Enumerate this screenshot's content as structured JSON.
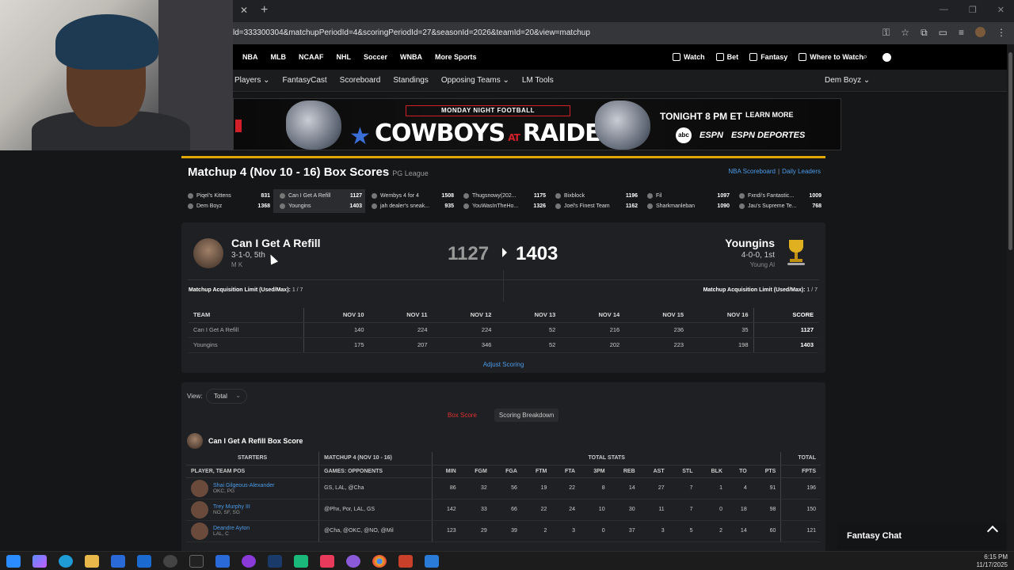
{
  "browser": {
    "url": "ld=333300304&matchupPeriodId=4&scoringPeriodId=27&seasonId=2026&teamId=20&view=matchup"
  },
  "espn_nav": {
    "sports": [
      "NBA",
      "MLB",
      "NCAAF",
      "NHL",
      "Soccer",
      "WNBA",
      "More Sports"
    ],
    "right": [
      "Watch",
      "Bet",
      "Fantasy",
      "Where to Watch"
    ]
  },
  "fantasy_nav": {
    "items": [
      "Players",
      "FantasyCast",
      "Scoreboard",
      "Standings",
      "Opposing Teams",
      "LM Tools"
    ],
    "team_menu": "Dem Boyz"
  },
  "ad": {
    "tag": "MONDAY NIGHT FOOTBALL",
    "team1": "COWBOYS",
    "at": "AT",
    "team2": "RAIDERS",
    "time": "TONIGHT 8 PM ET",
    "cta": "LEARN MORE",
    "networks": [
      "abc",
      "ESPN",
      "ESPN DEPORTES"
    ]
  },
  "header": {
    "title": "Matchup 4 (Nov 10 - 16) Box Scores",
    "league": "PG League",
    "link1": "NBA Scoreboard",
    "link2": "Daily Leaders"
  },
  "ticker": [
    {
      "t1": "Piqel's Kittens",
      "s1": "831",
      "t2": "Dem Boyz",
      "s2": "1368"
    },
    {
      "t1": "Can I Get A Refill",
      "s1": "1127",
      "t2": "Youngins",
      "s2": "1403"
    },
    {
      "t1": "Wembys 4 for 4",
      "s1": "1508",
      "t2": "jah dealer's sneak...",
      "s2": "935"
    },
    {
      "t1": "Thugsnowy(202...",
      "s1": "1175",
      "t2": "YouWasInTheHo...",
      "s2": "1326"
    },
    {
      "t1": "Bixblock",
      "s1": "1196",
      "t2": "Joel's Finest Team",
      "s2": "1162"
    },
    {
      "t1": "Fil",
      "s1": "1097",
      "t2": "Sharkmanleban",
      "s2": "1090"
    },
    {
      "t1": "Fxndi's Fantastic...",
      "s1": "1009",
      "t2": "Jau's Supreme Te...",
      "s2": "768"
    }
  ],
  "matchup": {
    "left": {
      "name": "Can I Get A Refill",
      "record": "3-1-0, 5th",
      "owner": "M K",
      "score": "1127"
    },
    "right": {
      "name": "Youngins",
      "record": "4-0-0, 1st",
      "owner": "Young Al",
      "score": "1403"
    },
    "acq_label": "Matchup Acquisition Limit (Used/Max):",
    "acq_left": "1 / 7",
    "acq_right": "1 / 7"
  },
  "daily": {
    "headers": [
      "TEAM",
      "NOV 10",
      "NOV 11",
      "NOV 12",
      "NOV 13",
      "NOV 14",
      "NOV 15",
      "NOV 16",
      "SCORE"
    ],
    "rows": [
      [
        "Can I Get A Refill",
        "140",
        "224",
        "224",
        "52",
        "216",
        "236",
        "35",
        "1127"
      ],
      [
        "Youngins",
        "175",
        "207",
        "346",
        "52",
        "202",
        "223",
        "198",
        "1403"
      ]
    ],
    "adjust": "Adjust Scoring"
  },
  "boxscore": {
    "view_label": "View:",
    "view_value": "Total",
    "tab_box": "Box Score",
    "tab_break": "Scoring Breakdown",
    "title": "Can I Get A Refill Box Score",
    "group_headers": [
      "STARTERS",
      "MATCHUP 4 (NOV 10 - 16)",
      "TOTAL STATS",
      "TOTAL"
    ],
    "col_headers": [
      "PLAYER, TEAM POS",
      "GAMES: OPPONENTS",
      "MIN",
      "FGM",
      "FGA",
      "FTM",
      "FTA",
      "3PM",
      "REB",
      "AST",
      "STL",
      "BLK",
      "TO",
      "PTS",
      "FPTS"
    ],
    "players": [
      {
        "name": "Shai Gilgeous-Alexander",
        "pos": "OKC, PG",
        "games": "GS, LAL, @Cha",
        "stats": [
          "86",
          "32",
          "56",
          "19",
          "22",
          "8",
          "14",
          "27",
          "7",
          "1",
          "4",
          "91"
        ],
        "fpts": "196"
      },
      {
        "name": "Trey Murphy III",
        "pos": "NO, SF, SG",
        "games": "@Phx, Por, LAL, GS",
        "stats": [
          "142",
          "33",
          "66",
          "22",
          "24",
          "10",
          "30",
          "11",
          "7",
          "0",
          "18",
          "98"
        ],
        "fpts": "150"
      },
      {
        "name": "Deandre Ayton",
        "pos": "LAL, C",
        "games": "@Cha, @OKC, @NO, @Mil",
        "stats": [
          "123",
          "29",
          "39",
          "2",
          "3",
          "0",
          "37",
          "3",
          "5",
          "2",
          "14",
          "60"
        ],
        "fpts": "121"
      }
    ]
  },
  "chat": {
    "label": "Fantasy Chat"
  },
  "taskbar": {
    "time": "6:15 PM",
    "date": "11/17/2025"
  }
}
